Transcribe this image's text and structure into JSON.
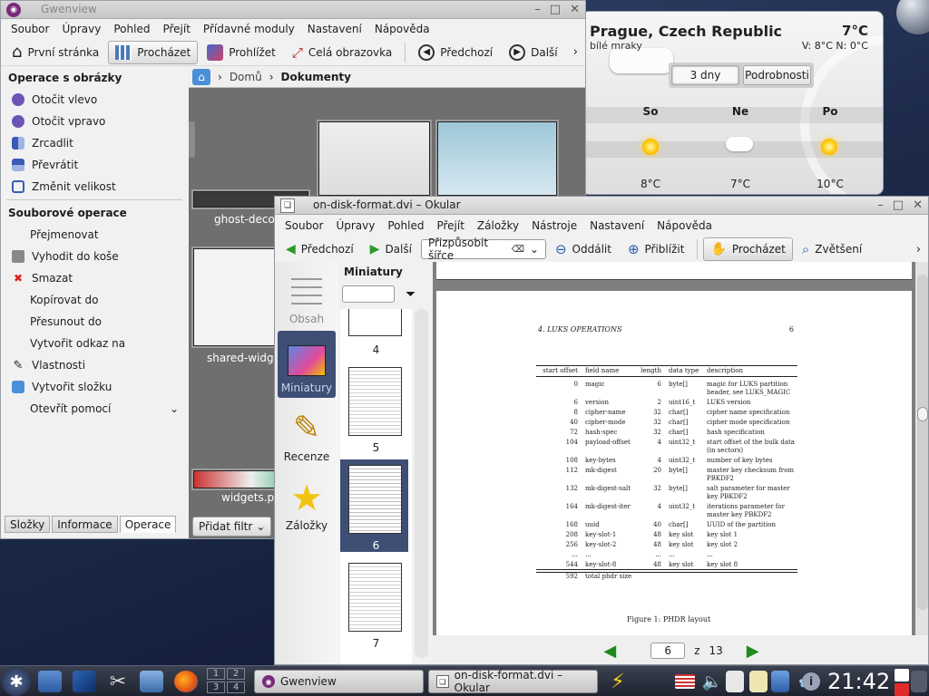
{
  "gwenview": {
    "title": "Gwenview",
    "menu": [
      "Soubor",
      "Úpravy",
      "Pohled",
      "Přejít",
      "Přídavné moduly",
      "Nastavení",
      "Nápověda"
    ],
    "toolbar": [
      "První stránka",
      "Procházet",
      "Prohlížet",
      "Celá obrazovka",
      "Předchozí",
      "Další"
    ],
    "ops_header": "Operace s obrázky",
    "ops": [
      "Otočit vlevo",
      "Otočit vpravo",
      "Zrcadlit",
      "Převrátit",
      "Změnit velikost"
    ],
    "file_header": "Souborové operace",
    "file_ops": [
      "Přejmenovat",
      "Vyhodit do koše",
      "Smazat",
      "Kopírovat do",
      "Přesunout do",
      "Vytvořit odkaz na",
      "Vlastnosti",
      "Vytvořit složku",
      "Otevřít pomocí"
    ],
    "tabs": [
      "Složky",
      "Informace",
      "Operace"
    ],
    "crumb": [
      "Domů",
      "Dokumenty"
    ],
    "thumbs": [
      "ghost-deco.p",
      "shared-widget",
      "widgets.pn"
    ],
    "filter": "Přidat filtr"
  },
  "weather": {
    "city": "Prague, Czech Republic",
    "desc": "bílé mraky",
    "temp": "7°C",
    "hilo": "V: 8°C N: 0°C",
    "btn_days": "3 dny",
    "btn_details": "Podrobnosti",
    "days": [
      "So",
      "Ne",
      "Po"
    ],
    "temps": [
      "8°C",
      "7°C",
      "10°C"
    ]
  },
  "okular": {
    "title": "on-disk-format.dvi – Okular",
    "menu": [
      "Soubor",
      "Úpravy",
      "Pohled",
      "Přejít",
      "Záložky",
      "Nástroje",
      "Nastavení",
      "Nápověda"
    ],
    "toolbar": {
      "prev": "Předchozí",
      "next": "Další",
      "fit": "Přizpůsobit šířce",
      "zoom_out": "Oddálit",
      "zoom_in": "Přiblížit",
      "browse": "Procházet",
      "magnify": "Zvětšení"
    },
    "side": [
      "Obsah",
      "Miniatury",
      "Recenze",
      "Záložky"
    ],
    "mini_title": "Miniatury",
    "mini_pages": [
      "4",
      "5",
      "6",
      "7"
    ],
    "nav": {
      "page": "6",
      "of": "z",
      "total": "13"
    },
    "doc": {
      "header_left": "4.  LUKS OPERATIONS",
      "header_right": "6",
      "cols": [
        "start offset",
        "field name",
        "length",
        "data type",
        "description"
      ],
      "rows": [
        [
          "0",
          "magic",
          "6",
          "byte[]",
          "magic for LUKS partition header, see LUKS_MAGIC"
        ],
        [
          "6",
          "version",
          "2",
          "uint16_t",
          "LUKS version"
        ],
        [
          "8",
          "cipher-name",
          "32",
          "char[]",
          "cipher name specification"
        ],
        [
          "40",
          "cipher-mode",
          "32",
          "char[]",
          "cipher mode specification"
        ],
        [
          "72",
          "hash-spec",
          "32",
          "char[]",
          "hash specification"
        ],
        [
          "104",
          "payload-offset",
          "4",
          "uint32_t",
          "start offset of the bulk data (in sectors)"
        ],
        [
          "108",
          "key-bytes",
          "4",
          "uint32_t",
          "number of key bytes"
        ],
        [
          "112",
          "mk-digest",
          "20",
          "byte[]",
          "master key checksum from PBKDF2"
        ],
        [
          "132",
          "mk-digest-salt",
          "32",
          "byte[]",
          "salt parameter for master key PBKDF2"
        ],
        [
          "164",
          "mk-digest-iter",
          "4",
          "uint32_t",
          "iterations parameter for master key PBKDF2"
        ],
        [
          "168",
          "uuid",
          "40",
          "char[]",
          "UUID of the partition"
        ],
        [
          "208",
          "key-slot-1",
          "48",
          "key slot",
          "key slot 1"
        ],
        [
          "256",
          "key-slot-2",
          "48",
          "key slot",
          "key slot 2"
        ],
        [
          "...",
          "...",
          "...",
          "...",
          "..."
        ],
        [
          "544",
          "key-slot-8",
          "48",
          "key slot",
          "key slot 8"
        ],
        [
          "592",
          "total phdr size",
          "",
          "",
          ""
        ]
      ],
      "caption": "Figure 1: PHDR layout"
    }
  },
  "taskbar": {
    "tasks": [
      "Gwenview",
      "on-disk-format.dvi – Okular"
    ],
    "pager": [
      "1",
      "2",
      "3",
      "4"
    ],
    "clock": "21:42"
  }
}
